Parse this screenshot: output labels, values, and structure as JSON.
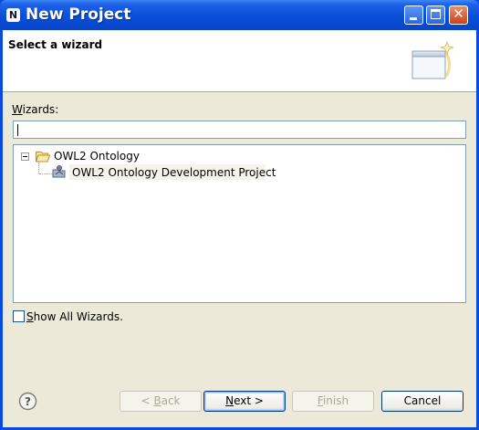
{
  "window": {
    "title": "New Project",
    "app_icon_glyph": "N",
    "close_glyph": "✕"
  },
  "header": {
    "title": "Select a wizard",
    "banner_icon": "wizard-banner-icon"
  },
  "filter": {
    "label_prefix": "W",
    "label_rest": "izards:",
    "value": "",
    "placeholder": ""
  },
  "tree": {
    "nodes": [
      {
        "label": "OWL2 Ontology",
        "icon": "folder-open-icon",
        "expanded": true
      },
      {
        "label": "OWL2 Ontology Development Project",
        "icon": "ontology-project-icon"
      }
    ]
  },
  "show_all": {
    "label_prefix": "S",
    "label_rest": "how All Wizards.",
    "checked": false
  },
  "buttons": {
    "back": {
      "prefix": "< ",
      "mnemonic": "B",
      "rest": "ack"
    },
    "next": {
      "mnemonic": "N",
      "rest": "ext >"
    },
    "finish": {
      "mnemonic": "F",
      "rest": "inish"
    },
    "cancel": "Cancel"
  },
  "colors": {
    "titlebar": "#0A4FD9",
    "dialog_bg": "#ECE9D8",
    "field_border": "#7F9DB9"
  }
}
